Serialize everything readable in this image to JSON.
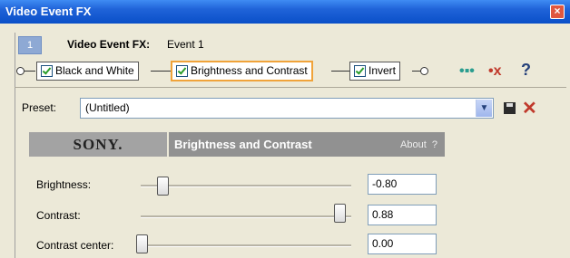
{
  "window": {
    "title": "Video Event FX"
  },
  "track": {
    "number": "1",
    "label": "Video Event FX:",
    "event": "Event 1"
  },
  "chain": {
    "plugins": [
      {
        "label": "Black and White",
        "checked": true
      },
      {
        "label": "Brightness and Contrast",
        "checked": true,
        "active": true
      },
      {
        "label": "Invert",
        "checked": true
      }
    ],
    "tools": {
      "help_label": "?"
    }
  },
  "preset": {
    "label": "Preset:",
    "value": "(Untitled)"
  },
  "plugin": {
    "brand": "SONY.",
    "name": "Brightness and Contrast",
    "about": "About",
    "about_help": "?",
    "params": [
      {
        "label": "Brightness:",
        "value": "-0.80",
        "level": 0.1
      },
      {
        "label": "Contrast:",
        "value": "0.88",
        "level": 0.94
      },
      {
        "label": "Contrast center:",
        "value": "0.00",
        "level": 0.0
      }
    ]
  },
  "colors": {
    "title_bar": "#0a4fc8",
    "active_plugin_border": "#f0a33a",
    "delete_icon": "#c0392b"
  }
}
